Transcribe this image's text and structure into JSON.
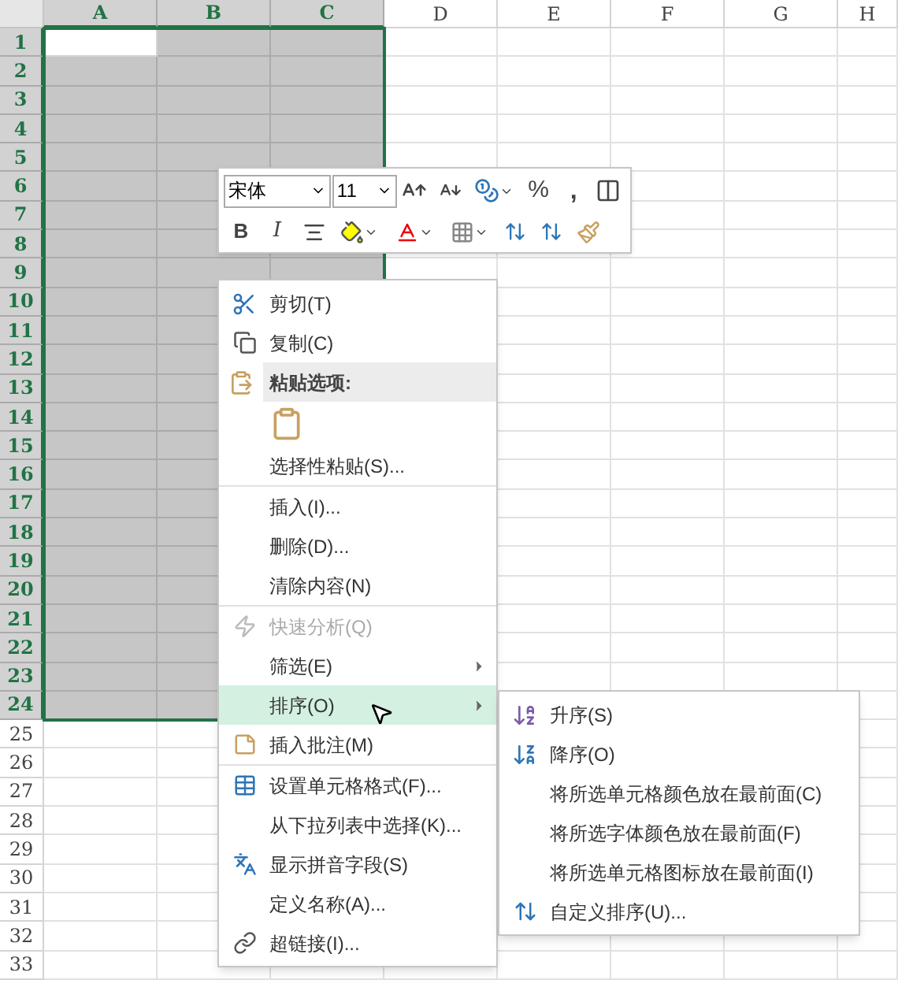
{
  "sheet": {
    "columns": [
      {
        "label": "A",
        "selected": true
      },
      {
        "label": "B",
        "selected": true
      },
      {
        "label": "C",
        "selected": true
      },
      {
        "label": "D",
        "selected": false
      },
      {
        "label": "E",
        "selected": false
      },
      {
        "label": "F",
        "selected": false
      },
      {
        "label": "G",
        "selected": false
      },
      {
        "label": "H",
        "selected": false
      }
    ],
    "rows": [
      {
        "label": "1",
        "selected": true
      },
      {
        "label": "2",
        "selected": true
      },
      {
        "label": "3",
        "selected": true
      },
      {
        "label": "4",
        "selected": true
      },
      {
        "label": "5",
        "selected": true
      },
      {
        "label": "6",
        "selected": true
      },
      {
        "label": "7",
        "selected": true
      },
      {
        "label": "8",
        "selected": true
      },
      {
        "label": "9",
        "selected": true
      },
      {
        "label": "10",
        "selected": true
      },
      {
        "label": "11",
        "selected": true
      },
      {
        "label": "12",
        "selected": true
      },
      {
        "label": "13",
        "selected": true
      },
      {
        "label": "14",
        "selected": true
      },
      {
        "label": "15",
        "selected": true
      },
      {
        "label": "16",
        "selected": true
      },
      {
        "label": "17",
        "selected": true
      },
      {
        "label": "18",
        "selected": true
      },
      {
        "label": "19",
        "selected": true
      },
      {
        "label": "20",
        "selected": true
      },
      {
        "label": "21",
        "selected": true
      },
      {
        "label": "22",
        "selected": true
      },
      {
        "label": "23",
        "selected": true
      },
      {
        "label": "24",
        "selected": true
      },
      {
        "label": "25",
        "selected": false
      },
      {
        "label": "26",
        "selected": false
      },
      {
        "label": "27",
        "selected": false
      },
      {
        "label": "28",
        "selected": false
      },
      {
        "label": "29",
        "selected": false
      },
      {
        "label": "30",
        "selected": false
      },
      {
        "label": "31",
        "selected": false
      },
      {
        "label": "32",
        "selected": false
      },
      {
        "label": "33",
        "selected": false
      }
    ]
  },
  "mini_toolbar": {
    "font": "宋体",
    "size": "11",
    "percent": "%",
    "comma": ",",
    "bold": "B",
    "italic": "I"
  },
  "context_menu": {
    "groups": [
      [
        {
          "kind": "command",
          "label": "剪切(T)",
          "disabled": false,
          "submenu": false,
          "selected": false
        },
        {
          "kind": "command",
          "label": "复制(C)",
          "disabled": false,
          "submenu": false,
          "selected": false
        },
        {
          "kind": "heading",
          "label": "粘贴选项:"
        },
        {
          "kind": "paste-options"
        },
        {
          "kind": "command",
          "label": "选择性粘贴(S)...",
          "disabled": false,
          "submenu": false,
          "selected": false
        }
      ],
      [
        {
          "kind": "command",
          "label": "插入(I)...",
          "disabled": false,
          "submenu": false,
          "selected": false
        },
        {
          "kind": "command",
          "label": "删除(D)...",
          "disabled": false,
          "submenu": false,
          "selected": false
        },
        {
          "kind": "command",
          "label": "清除内容(N)",
          "disabled": false,
          "submenu": false,
          "selected": false
        }
      ],
      [
        {
          "kind": "command",
          "label": "快速分析(Q)",
          "disabled": true,
          "submenu": false,
          "selected": false
        },
        {
          "kind": "command",
          "label": "筛选(E)",
          "disabled": false,
          "submenu": true,
          "selected": false
        },
        {
          "kind": "command",
          "label": "排序(O)",
          "disabled": false,
          "submenu": true,
          "selected": true
        },
        {
          "kind": "command",
          "label": "插入批注(M)",
          "disabled": false,
          "submenu": false,
          "selected": false
        }
      ],
      [
        {
          "kind": "command",
          "label": "设置单元格格式(F)...",
          "disabled": false,
          "submenu": false,
          "selected": false
        },
        {
          "kind": "command",
          "label": "从下拉列表中选择(K)...",
          "disabled": false,
          "submenu": false,
          "selected": false
        },
        {
          "kind": "command",
          "label": "显示拼音字段(S)",
          "disabled": false,
          "submenu": false,
          "selected": false
        },
        {
          "kind": "command",
          "label": "定义名称(A)...",
          "disabled": false,
          "submenu": false,
          "selected": false
        },
        {
          "kind": "command",
          "label": "超链接(I)...",
          "disabled": false,
          "submenu": false,
          "selected": false
        }
      ]
    ]
  },
  "sort_submenu": {
    "items": [
      {
        "label": "升序(S)"
      },
      {
        "label": "降序(O)"
      },
      {
        "label": "将所选单元格颜色放在最前面(C)"
      },
      {
        "label": "将所选字体颜色放在最前面(F)"
      },
      {
        "label": "将所选单元格图标放在最前面(I)"
      },
      {
        "label": "自定义排序(U)..."
      }
    ]
  }
}
